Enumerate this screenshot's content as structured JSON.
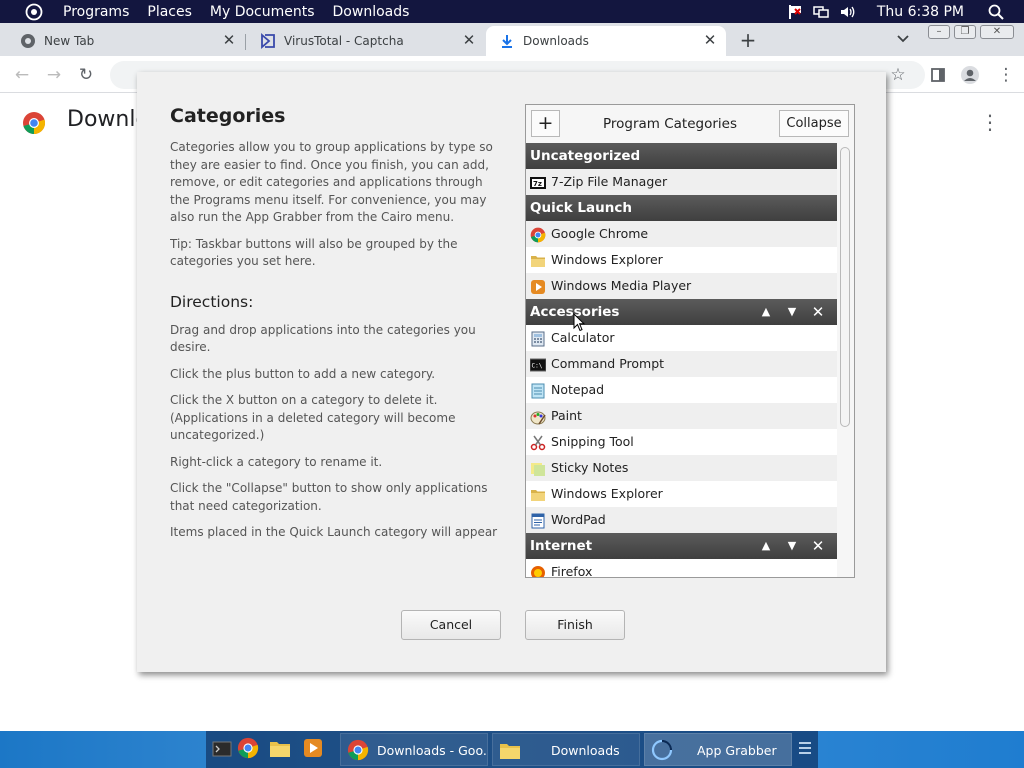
{
  "menubar": {
    "items": [
      "Programs",
      "Places",
      "My Documents",
      "Downloads"
    ],
    "clock": "Thu 6:38 PM"
  },
  "tabs": [
    {
      "title": "New Tab",
      "icon": "chrome-icon"
    },
    {
      "title": "VirusTotal - Captcha",
      "icon": "virustotal-icon"
    },
    {
      "title": "Downloads",
      "icon": "download-icon"
    }
  ],
  "page": {
    "title": "Downlo"
  },
  "dialog": {
    "heading": "Categories",
    "intro": "Categories allow you to group applications by type so they are easier to find. Once you finish, you can add, remove, or edit categories and applications through the Programs menu itself. For convenience, you may also run the App Grabber from the Cairo menu.",
    "tip": "Tip: Taskbar buttons will also be grouped by the categories you set here.",
    "directions_heading": "Directions:",
    "directions": [
      "Drag and drop applications into the categories you desire.",
      "Click the plus button to add a new category.",
      "Click the X button on a category to delete it. (Applications in a deleted category will become uncategorized.)",
      "Right-click a category to rename it.",
      "Click the \"Collapse\" button to show only applications that need categorization.",
      "Items placed in the Quick Launch category will appear in the quick launch area of the Cairo taskbar. Items placed here will not be removed from the Programs menu.  To"
    ],
    "panel": {
      "add_label": "+",
      "title": "Program Categories",
      "collapse_label": "Collapse",
      "categories": [
        {
          "name": "Uncategorized",
          "controls": false,
          "apps": [
            {
              "name": "7-Zip File Manager",
              "icon": "7zip-icon"
            }
          ]
        },
        {
          "name": "Quick Launch",
          "controls": false,
          "apps": [
            {
              "name": "Google Chrome",
              "icon": "chrome-icon"
            },
            {
              "name": "Windows Explorer",
              "icon": "folder-icon"
            },
            {
              "name": "Windows Media Player",
              "icon": "media-player-icon"
            }
          ]
        },
        {
          "name": "Accessories",
          "controls": true,
          "apps": [
            {
              "name": "Calculator",
              "icon": "calculator-icon"
            },
            {
              "name": "Command Prompt",
              "icon": "cmd-icon"
            },
            {
              "name": "Notepad",
              "icon": "notepad-icon"
            },
            {
              "name": "Paint",
              "icon": "paint-icon"
            },
            {
              "name": "Snipping Tool",
              "icon": "scissors-icon"
            },
            {
              "name": "Sticky Notes",
              "icon": "sticky-note-icon"
            },
            {
              "name": "Windows Explorer",
              "icon": "folder-icon"
            },
            {
              "name": "WordPad",
              "icon": "wordpad-icon"
            }
          ]
        },
        {
          "name": "Internet",
          "controls": true,
          "apps": [
            {
              "name": "Firefox",
              "icon": "firefox-icon"
            }
          ]
        }
      ]
    },
    "cancel_label": "Cancel",
    "finish_label": "Finish"
  },
  "taskbar": {
    "tasks": [
      {
        "label": "Downloads - Goo...",
        "icon": "chrome-icon"
      },
      {
        "label": "Downloads",
        "icon": "folder-icon"
      },
      {
        "label": "App Grabber",
        "icon": "cairo-icon"
      }
    ]
  },
  "colors": {
    "menubar_bg": "#13163f",
    "category_header": "#4a4a4a",
    "taskbar": "#1f7dd0"
  }
}
